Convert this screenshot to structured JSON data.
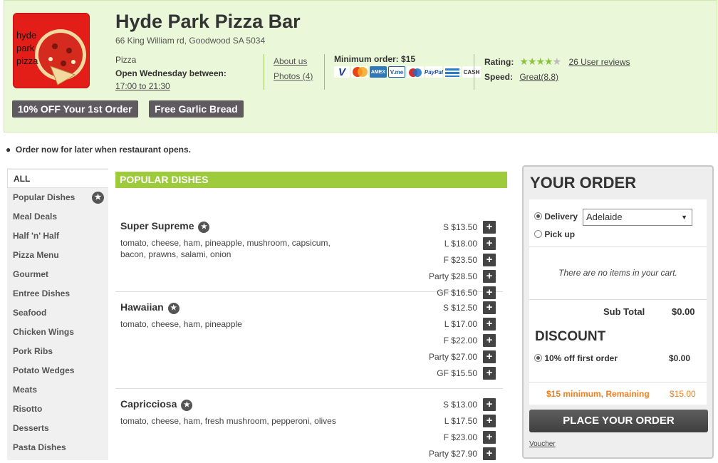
{
  "restaurant": {
    "logo_lines": [
      "hyde",
      "park",
      "pizza"
    ],
    "name": "Hyde Park Pizza Bar",
    "address": "66 King William rd, Goodwood SA 5034",
    "category": "Pizza",
    "open_label": "Open Wednesday between:",
    "hours": "17:00 to 21:30",
    "about_link": "About us",
    "photos_link": "Photos (4)",
    "min_order_label": "Minimum order:",
    "min_order_value": "$15",
    "rating_label": "Rating:",
    "rating_stars": 4.5,
    "reviews_link": "26 User reviews",
    "speed_label": "Speed:",
    "speed_value": "Great(8.8)"
  },
  "payment_icons": [
    {
      "name": "visa-icon",
      "color": "#1a3d8f"
    },
    {
      "name": "mastercard-icon",
      "color": "#e8441a"
    },
    {
      "name": "amex-icon",
      "color": "#2e77bb"
    },
    {
      "name": "vme-icon",
      "color": "#1a5aa3"
    },
    {
      "name": "maestro-icon",
      "color": "#d42e2e"
    },
    {
      "name": "paypal-icon",
      "color": "#1c4d9c"
    },
    {
      "name": "bank-icon",
      "color": "#2c7ccc"
    },
    {
      "name": "cash-icon",
      "color": "#333333"
    }
  ],
  "promos": [
    "10% OFF Your 1st Order",
    "Free Garlic Bread"
  ],
  "notice": "Order now for later when restaurant opens.",
  "sidebar": {
    "items": [
      {
        "label": "ALL"
      },
      {
        "label": "Popular Dishes"
      },
      {
        "label": "Meal Deals"
      },
      {
        "label": "Half 'n' Half"
      },
      {
        "label": "Pizza Menu"
      },
      {
        "label": "Gourmet"
      },
      {
        "label": "Entree Dishes"
      },
      {
        "label": "Seafood"
      },
      {
        "label": "Chicken Wings"
      },
      {
        "label": "Pork Ribs"
      },
      {
        "label": "Potato Wedges"
      },
      {
        "label": "Meats"
      },
      {
        "label": "Risotto"
      },
      {
        "label": "Desserts"
      },
      {
        "label": "Pasta Dishes"
      }
    ]
  },
  "menu": {
    "section_title": "POPULAR DISHES",
    "dishes": [
      {
        "name": "Super Supreme",
        "description": "tomato, cheese, ham, pineapple, mushroom, capsicum, bacon, prawns, salami, onion",
        "prices": [
          "S $13.50",
          "L $18.00",
          "F $23.50",
          "Party $28.50",
          "GF $16.50"
        ]
      },
      {
        "name": "Hawaiian",
        "description": "tomato, cheese, ham, pineapple",
        "prices": [
          "S $12.50",
          "L $17.00",
          "F $22.00",
          "Party $27.00",
          "GF $15.50"
        ]
      },
      {
        "name": "Capricciosa",
        "description": "tomato, cheese, ham, fresh mushroom, pepperoni, olives",
        "prices": [
          "S $13.00",
          "L $17.50",
          "F $23.00",
          "Party $27.90"
        ]
      }
    ]
  },
  "order": {
    "title": "YOUR ORDER",
    "delivery_label": "Delivery",
    "suburb": "Adelaide",
    "pickup_label": "Pick up",
    "empty_text": "There are no items in your cart.",
    "subtotal_label": "Sub Total",
    "subtotal_value": "$0.00",
    "discount_title": "DISCOUNT",
    "discount_label": "10% off first order",
    "discount_value": "$0.00",
    "remaining_label": "$15 minimum, Remaining",
    "remaining_value": "$15.00",
    "place_button": "PLACE YOUR ORDER",
    "voucher_link": "Voucher"
  }
}
